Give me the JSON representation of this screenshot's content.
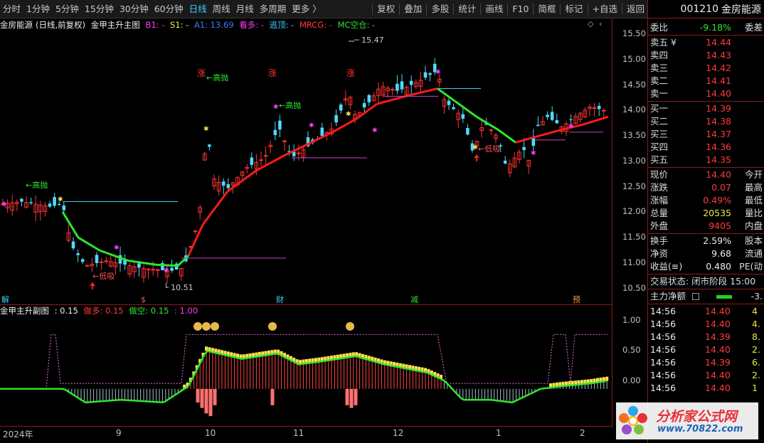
{
  "toolbar": {
    "periods": [
      "分时",
      "1分钟",
      "5分钟",
      "15分钟",
      "30分钟",
      "60分钟",
      "日线",
      "周线",
      "月线",
      "多周期",
      "更多 〉"
    ],
    "active": "日线",
    "actions": [
      "复权",
      "叠加",
      "多股",
      "统计",
      "画线",
      "F10",
      "简框",
      "标记",
      "+自选",
      "返回"
    ]
  },
  "main_title": {
    "stock": "金房能源",
    "mode": "(日线,前复权)",
    "indicator": "金甲主升主图",
    "b1": "B1: -",
    "s1": "S1: -",
    "a1": "A1: 13.69",
    "kanduo": "看多: -",
    "taoding": "逃顶: -",
    "mrcg": "MRCG: -",
    "mckh": "MC空仓: -"
  },
  "price_axis": [
    "15.50",
    "15.00",
    "14.50",
    "14.00",
    "13.50",
    "13.00",
    "12.50",
    "12.00",
    "11.50",
    "11.00",
    "10.50"
  ],
  "price_range": [
    10.35,
    15.65
  ],
  "annotations": {
    "high": "15.47",
    "low": "10.51",
    "gaopao": "高抛",
    "dixi": "低吸"
  },
  "markers": {
    "m1": "解",
    "m2": "$",
    "m3": "财",
    "m4": "减",
    "m5": "预"
  },
  "sub_title": {
    "name": "金甲主升副图",
    "v1": ": 0.15",
    "zuoduo": "做多: 0.15",
    "zuokong": "做空: 0.15",
    "v2": ": 1.00"
  },
  "sub_axis": [
    "1.00",
    "0.50",
    "0.00"
  ],
  "sub_labels": {
    "zhang": "涨"
  },
  "x_axis": [
    "2024年",
    "9",
    "10",
    "11",
    "12",
    "1",
    "2"
  ],
  "panel": {
    "code": "001210",
    "name": "金房能源",
    "weibi_label": "委比",
    "weibi": "-9.18%",
    "weicha_label": "委差",
    "asks": [
      {
        "l": "卖五 ¥",
        "v": "14.44"
      },
      {
        "l": "卖四",
        "v": "14.43"
      },
      {
        "l": "卖三",
        "v": "14.42"
      },
      {
        "l": "卖二",
        "v": "14.41"
      },
      {
        "l": "卖一",
        "v": "14.40"
      }
    ],
    "bids": [
      {
        "l": "买一",
        "v": "14.39"
      },
      {
        "l": "买二",
        "v": "14.38"
      },
      {
        "l": "买三",
        "v": "14.37"
      },
      {
        "l": "买四",
        "v": "14.36"
      },
      {
        "l": "买五",
        "v": "14.35"
      }
    ],
    "stats": [
      {
        "l": "现价",
        "v": "14.40",
        "r": "今开",
        "c": "red"
      },
      {
        "l": "涨跌",
        "v": "0.07",
        "r": "最高",
        "c": "red"
      },
      {
        "l": "涨幅",
        "v": "0.49%",
        "r": "最低",
        "c": "red"
      },
      {
        "l": "总量",
        "v": "20535",
        "r": "量比",
        "c": "yellow"
      },
      {
        "l": "外盘",
        "v": "9405",
        "r": "内盘",
        "c": "red"
      }
    ],
    "stats2": [
      {
        "l": "换手",
        "v": "2.59%",
        "r": "股本",
        "c": "white"
      },
      {
        "l": "净资",
        "v": "9.68",
        "r": "流通",
        "c": "white"
      },
      {
        "l": "收益(≡)",
        "v": "0.480",
        "r": "PE(动",
        "c": "white"
      }
    ],
    "trade_state": "交易状态: 闭市阶段 15:00",
    "main_flow_label": "主力净额",
    "main_flow_val": "-3.",
    "ticks": [
      {
        "t": "14:56",
        "p": "14.40",
        "v": "4"
      },
      {
        "t": "14:56",
        "p": "14.40",
        "v": "4."
      },
      {
        "t": "14:56",
        "p": "14.39",
        "v": "8."
      },
      {
        "t": "14:56",
        "p": "14.40",
        "v": "2."
      },
      {
        "t": "14:56",
        "p": "14.39",
        "v": "6."
      },
      {
        "t": "14:56",
        "p": "14.40",
        "v": "2."
      },
      {
        "t": "14:56",
        "p": "14.40",
        "v": "1"
      }
    ]
  },
  "watermark": {
    "title": "分析家公式网",
    "url": "www.70822.com"
  }
}
